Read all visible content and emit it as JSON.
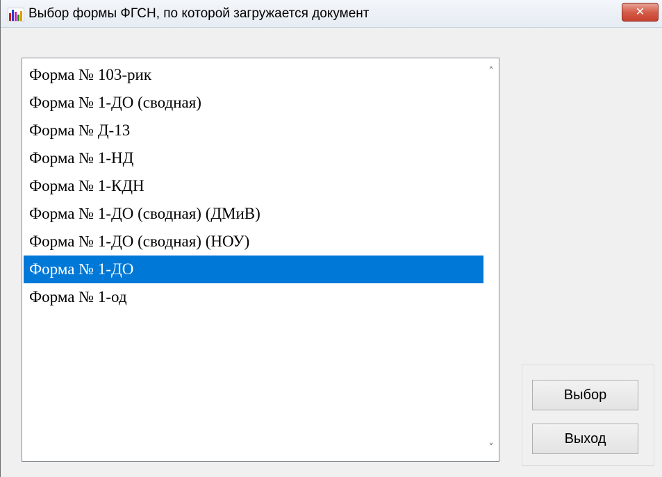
{
  "window": {
    "title": "Выбор формы ФГСН, по которой загружается документ",
    "icon": "bar-chart-app-icon",
    "close_label": "✕"
  },
  "list": {
    "items": [
      {
        "label": "Форма № 103-рик",
        "selected": false
      },
      {
        "label": "Форма № 1-ДО (сводная)",
        "selected": false
      },
      {
        "label": "Форма № Д-13",
        "selected": false
      },
      {
        "label": "Форма № 1-НД",
        "selected": false
      },
      {
        "label": "Форма № 1-КДН",
        "selected": false
      },
      {
        "label": "Форма № 1-ДО (сводная) (ДМиВ)",
        "selected": false
      },
      {
        "label": "Форма № 1-ДО (сводная) (НОУ)",
        "selected": false
      },
      {
        "label": "Форма № 1-ДО",
        "selected": true
      },
      {
        "label": "Форма № 1-од",
        "selected": false
      }
    ],
    "scroll_up_icon": "chevron-up-icon",
    "scroll_down_icon": "chevron-down-icon",
    "selection_color": "#0078d7"
  },
  "buttons": {
    "select_label": "Выбор",
    "exit_label": "Выход"
  }
}
